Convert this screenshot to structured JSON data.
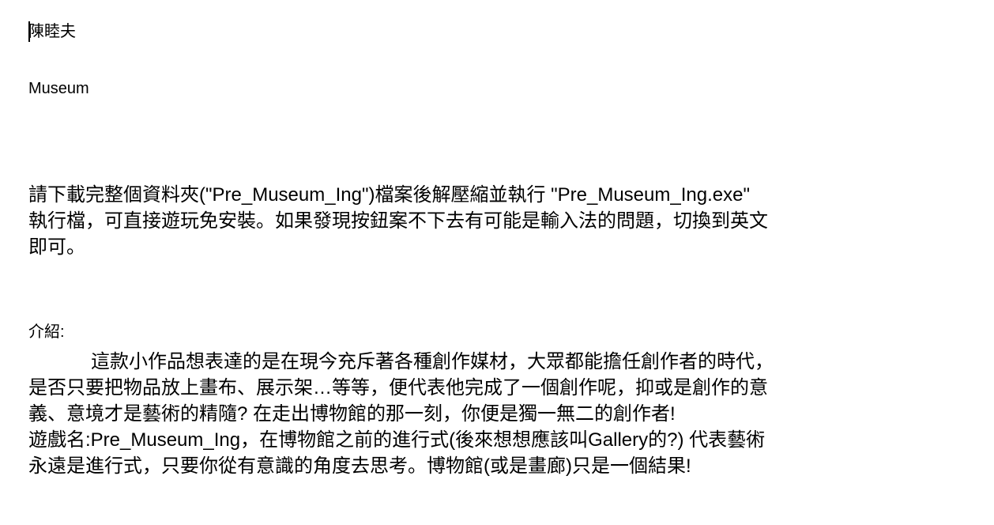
{
  "document": {
    "author": "陳睦夫",
    "title": "Museum",
    "instructions": [
      "請下載完整個資料夾(\"Pre_Museum_Ing\")檔案後解壓縮並執行 \"Pre_Museum_Ing.exe\"",
      "執行檔，可直接遊玩免安裝。如果發現按鈕案不下去有可能是輸入法的問題，切換到英文",
      "即可。"
    ],
    "intro_label": "介紹:",
    "intro_lines": [
      "這款小作品想表達的是在現今充斥著各種創作媒材，大眾都能擔任創作者的時代，",
      "是否只要把物品放上畫布、展示架…等等，便代表他完成了一個創作呢，抑或是創作的意",
      "義、意境才是藝術的精隨? 在走出博物館的那一刻，你便是獨一無二的創作者!",
      "遊戲名:Pre_Museum_Ing，在博物館之前的進行式(後來想想應該叫Gallery的?) 代表藝術",
      "永遠是進行式，只要你從有意識的角度去思考。博物館(或是畫廊)只是一個結果!"
    ]
  }
}
